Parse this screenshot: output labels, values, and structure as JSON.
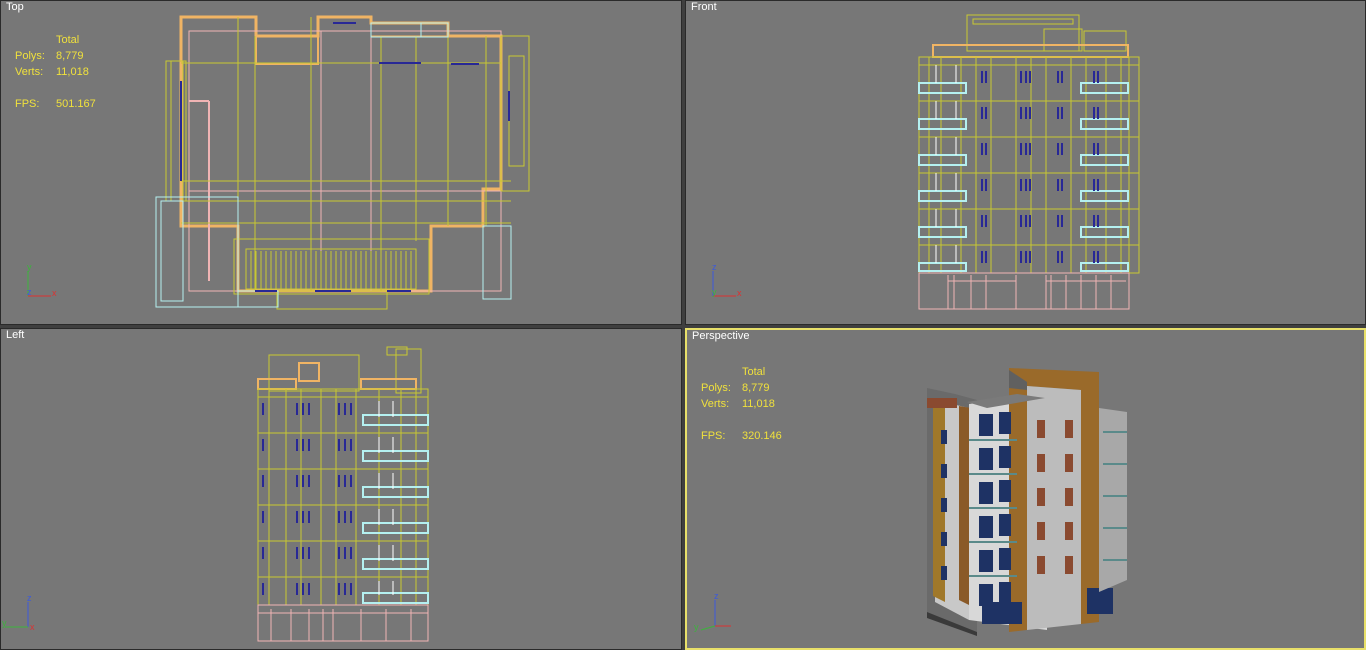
{
  "viewports": {
    "top": {
      "label": "Top",
      "stats": {
        "header": "Total",
        "polys_label": "Polys:",
        "polys": "8,779",
        "verts_label": "Verts:",
        "verts": "11,018",
        "fps_label": "FPS:",
        "fps": "501.167"
      },
      "axes": {
        "up": "y",
        "right": "x",
        "corner": "z"
      }
    },
    "front": {
      "label": "Front",
      "axes": {
        "up": "z",
        "right": "x",
        "corner": "y"
      }
    },
    "left": {
      "label": "Left",
      "axes": {
        "up": "z",
        "right": "x",
        "corner": "y"
      }
    },
    "perspective": {
      "label": "Perspective",
      "active": true,
      "stats": {
        "header": "Total",
        "polys_label": "Polys:",
        "polys": "8,779",
        "verts_label": "Verts:",
        "verts": "11,018",
        "fps_label": "FPS:",
        "fps": "320.146"
      },
      "axes": {
        "up": "z",
        "right": "x",
        "corner": "y"
      }
    }
  },
  "colors": {
    "viewport_bg": "#777777",
    "active_border": "#e8e06a",
    "stats_text": "#f0e13c",
    "wire_yellow": "#c8c832",
    "wire_orange": "#f0b464",
    "wire_pink": "#f0b4b4",
    "wire_cyan": "#b4f0f0",
    "window_blue": "#282896"
  }
}
